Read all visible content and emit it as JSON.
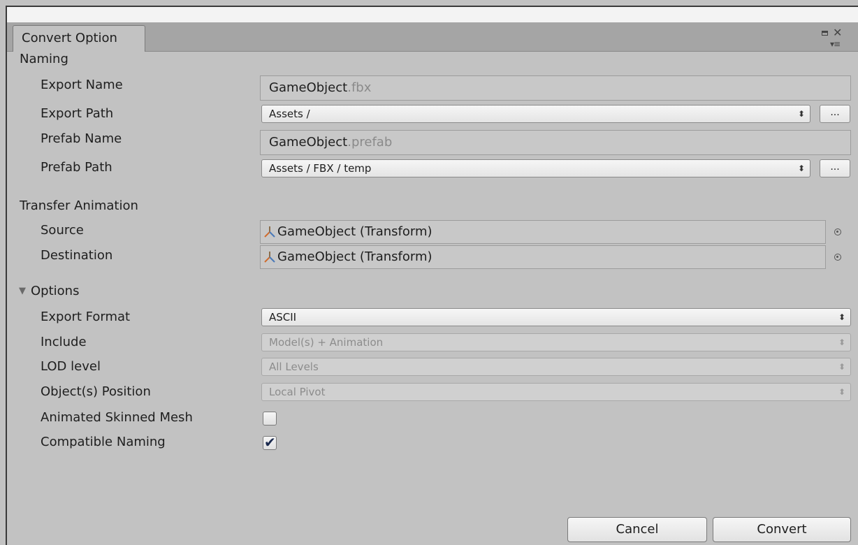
{
  "window": {
    "tab_title": "Convert Option"
  },
  "naming": {
    "header": "Naming",
    "export_name": {
      "label": "Export Name",
      "value": "GameObject",
      "extension": ".fbx"
    },
    "export_path": {
      "label": "Export Path",
      "value": "Assets /",
      "browse_label": "..."
    },
    "prefab_name": {
      "label": "Prefab Name",
      "value": "GameObject",
      "extension": ".prefab"
    },
    "prefab_path": {
      "label": "Prefab Path",
      "value": "Assets / FBX / temp",
      "browse_label": "..."
    }
  },
  "transfer_animation": {
    "header": "Transfer Animation",
    "source": {
      "label": "Source",
      "value": "GameObject (Transform)",
      "icon": "transform-icon"
    },
    "destination": {
      "label": "Destination",
      "value": "GameObject (Transform)",
      "icon": "transform-icon"
    }
  },
  "options": {
    "header": "Options",
    "expanded": true,
    "export_format": {
      "label": "Export Format",
      "value": "ASCII"
    },
    "include": {
      "label": "Include",
      "value": "Model(s) + Animation",
      "enabled": false
    },
    "lod_level": {
      "label": "LOD level",
      "value": "All Levels",
      "enabled": false
    },
    "object_position": {
      "label": "Object(s) Position",
      "value": "Local Pivot",
      "enabled": false
    },
    "animated_skinned_mesh": {
      "label": "Animated Skinned Mesh",
      "checked": false
    },
    "compatible_naming": {
      "label": "Compatible Naming",
      "checked": true
    }
  },
  "footer": {
    "cancel_label": "Cancel",
    "convert_label": "Convert"
  },
  "colors": {
    "panel": "#c2c2c2",
    "tabbar": "#a5a5a5",
    "check": "#1b2a4e"
  }
}
